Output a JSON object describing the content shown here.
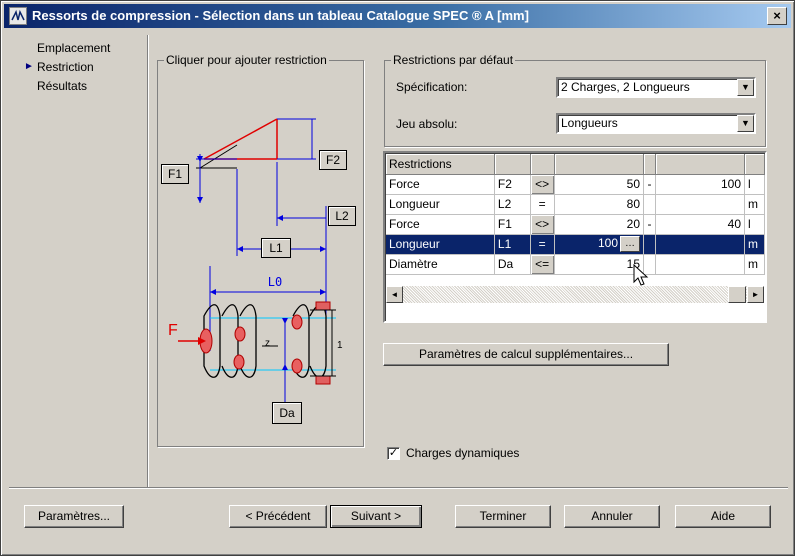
{
  "window": {
    "title": "Ressorts de compression - Sélection dans un tableau Catalogue SPEC ® A [mm]",
    "close_glyph": "×"
  },
  "nav": {
    "items": [
      {
        "label": "Emplacement",
        "active": false
      },
      {
        "label": "Restriction",
        "active": true
      },
      {
        "label": "Résultats",
        "active": false
      }
    ],
    "arrow_glyph": "►"
  },
  "diagram_group": {
    "legend": "Cliquer pour ajouter restriction",
    "labels": {
      "f1": "F1",
      "f2": "F2",
      "l2": "L2",
      "l1": "L1",
      "l0": "L0",
      "da": "Da",
      "f": "F",
      "z": "z",
      "one": "1"
    },
    "colors": {
      "red": "#e00000",
      "blue": "#0000e0",
      "cyan": "#00c8ff",
      "hatch": "#e00000"
    }
  },
  "defaults_group": {
    "legend": "Restrictions par défaut",
    "specification": {
      "label": "Spécification:",
      "value": "2 Charges, 2 Longueurs"
    },
    "jeu": {
      "label": "Jeu absolu:",
      "value": "Longueurs"
    }
  },
  "grid": {
    "header": [
      "Restrictions",
      "",
      "",
      "",
      "",
      "",
      ""
    ],
    "rows": [
      {
        "name": "Force",
        "sym": "F2",
        "op": "<>",
        "v1": "50",
        "dash": "-",
        "v2": "100",
        "unit": "l",
        "selected": false
      },
      {
        "name": "Longueur",
        "sym": "L2",
        "op": "=",
        "v1": "80",
        "dash": "",
        "v2": "",
        "unit": "m",
        "selected": false
      },
      {
        "name": "Force",
        "sym": "F1",
        "op": "<>",
        "v1": "20",
        "dash": "-",
        "v2": "40",
        "unit": "l",
        "selected": false
      },
      {
        "name": "Longueur",
        "sym": "L1",
        "op": "=",
        "v1": "100",
        "dash": "",
        "v2": "",
        "unit": "m",
        "selected": true
      },
      {
        "name": "Diamètre",
        "sym": "Da",
        "op": "<=",
        "v1": "15",
        "dash": "",
        "v2": "",
        "unit": "m",
        "selected": false
      }
    ],
    "scroll_left": "◄",
    "scroll_right": "►"
  },
  "extra_button": "Paramètres de calcul supplémentaires...",
  "checkbox": {
    "label": "Charges dynamiques",
    "checked": true,
    "mark": "✓"
  },
  "footer": {
    "parametres": "Paramètres...",
    "precedent": "< Précédent",
    "suivant": "Suivant >",
    "terminer": "Terminer",
    "annuler": "Annuler",
    "aide": "Aide"
  },
  "combo_arrow": "▼"
}
